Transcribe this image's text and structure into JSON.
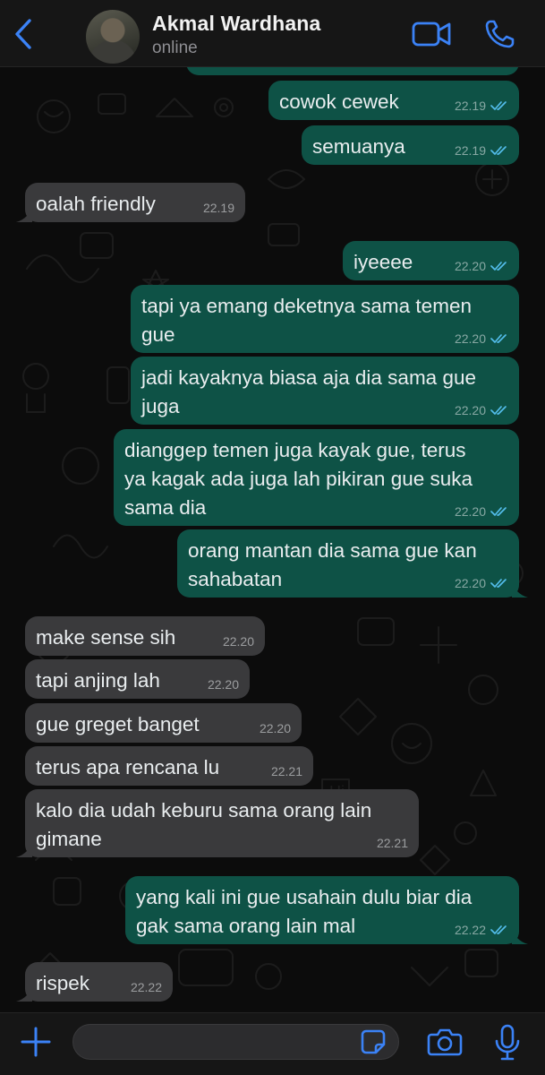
{
  "header": {
    "contact_name": "Akmal Wardhana",
    "status": "online",
    "back_icon": "chevron-left-icon",
    "video_icon": "video-call-icon",
    "call_icon": "phone-icon"
  },
  "theme": {
    "accent": "#3b82f6",
    "outgoing_bubble": "#0e5246",
    "incoming_bubble": "#3a3a3c",
    "read_ticks": "#53bdeb"
  },
  "messages": [
    {
      "dir": "out",
      "lines": [
        ""
      ],
      "time": "22.19",
      "read": true
    },
    {
      "dir": "out",
      "lines": [
        "cowok cewek"
      ],
      "time": "22.19",
      "read": true
    },
    {
      "dir": "out",
      "lines": [
        "semuanya"
      ],
      "time": "22.19",
      "read": true
    },
    {
      "dir": "in",
      "lines": [
        "oalah friendly"
      ],
      "time": "22.19"
    },
    {
      "dir": "out",
      "lines": [
        "iyeeee"
      ],
      "time": "22.20",
      "read": true
    },
    {
      "dir": "out",
      "lines": [
        "tapi ya emang deketnya sama temen",
        "gue"
      ],
      "time": "22.20",
      "read": true
    },
    {
      "dir": "out",
      "lines": [
        "jadi kayaknya biasa aja dia sama gue",
        "juga"
      ],
      "time": "22.20",
      "read": true
    },
    {
      "dir": "out",
      "lines": [
        "dianggep temen juga kayak gue, terus",
        "ya kagak ada juga lah pikiran gue suka",
        "sama dia"
      ],
      "time": "22.20",
      "read": true
    },
    {
      "dir": "out",
      "lines": [
        "orang mantan dia sama gue kan",
        "sahabatan"
      ],
      "time": "22.20",
      "read": true
    },
    {
      "dir": "in",
      "lines": [
        "make sense sih"
      ],
      "time": "22.20"
    },
    {
      "dir": "in",
      "lines": [
        "tapi anjing lah"
      ],
      "time": "22.20"
    },
    {
      "dir": "in",
      "lines": [
        "gue greget banget"
      ],
      "time": "22.20"
    },
    {
      "dir": "in",
      "lines": [
        "terus apa rencana lu"
      ],
      "time": "22.21"
    },
    {
      "dir": "in",
      "lines": [
        "kalo dia udah keburu sama orang lain",
        "gimane"
      ],
      "time": "22.21"
    },
    {
      "dir": "out",
      "lines": [
        "yang kali ini gue usahain dulu biar dia",
        "gak sama orang lain mal"
      ],
      "time": "22.22",
      "read": true
    },
    {
      "dir": "in",
      "lines": [
        "rispek"
      ],
      "time": "22.22"
    }
  ],
  "input_bar": {
    "plus_icon": "plus-icon",
    "placeholder": "",
    "sticker_icon": "sticker-icon",
    "camera_icon": "camera-icon",
    "mic_icon": "microphone-icon"
  }
}
